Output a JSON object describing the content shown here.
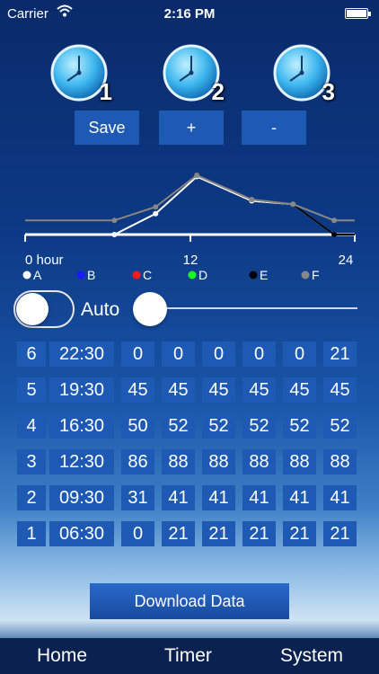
{
  "status": {
    "carrier": "Carrier",
    "time": "2:16 PM"
  },
  "clocks": [
    {
      "number": "1",
      "icon": "clock-icon"
    },
    {
      "number": "2",
      "icon": "clock-icon"
    },
    {
      "number": "3",
      "icon": "clock-icon"
    }
  ],
  "buttons": {
    "save": "Save",
    "plus": "+",
    "minus": "-"
  },
  "chart_data": {
    "type": "line",
    "x_ticks": [
      "0 hour",
      "12",
      "24"
    ],
    "xlim": [
      0,
      24
    ],
    "ylim": [
      0,
      100
    ],
    "legend": [
      {
        "name": "A",
        "color": "#ffffff"
      },
      {
        "name": "B",
        "color": "#1a1aff"
      },
      {
        "name": "C",
        "color": "#ff1a1a"
      },
      {
        "name": "D",
        "color": "#1aff1a"
      },
      {
        "name": "E",
        "color": "#000000"
      },
      {
        "name": "F",
        "color": "#888888"
      }
    ],
    "x": [
      6.5,
      9.5,
      12.5,
      16.5,
      19.5,
      22.5
    ],
    "series": [
      {
        "name": "A",
        "color": "#ffffff",
        "values": [
          0,
          31,
          86,
          50,
          45,
          0
        ]
      },
      {
        "name": "E",
        "color": "#000000",
        "values": [
          21,
          41,
          88,
          52,
          45,
          0
        ]
      },
      {
        "name": "F",
        "color": "#888888",
        "values": [
          21,
          41,
          88,
          52,
          45,
          21
        ]
      }
    ]
  },
  "controls": {
    "auto_label": "Auto",
    "auto_on": false,
    "slider_value": 0
  },
  "table": {
    "rows": [
      {
        "index": "6",
        "time": "22:30",
        "values": [
          "0",
          "0",
          "0",
          "0",
          "0",
          "21"
        ]
      },
      {
        "index": "5",
        "time": "19:30",
        "values": [
          "45",
          "45",
          "45",
          "45",
          "45",
          "45"
        ]
      },
      {
        "index": "4",
        "time": "16:30",
        "values": [
          "50",
          "52",
          "52",
          "52",
          "52",
          "52"
        ]
      },
      {
        "index": "3",
        "time": "12:30",
        "values": [
          "86",
          "88",
          "88",
          "88",
          "88",
          "88"
        ]
      },
      {
        "index": "2",
        "time": "09:30",
        "values": [
          "31",
          "41",
          "41",
          "41",
          "41",
          "41"
        ]
      },
      {
        "index": "1",
        "time": "06:30",
        "values": [
          "0",
          "21",
          "21",
          "21",
          "21",
          "21"
        ]
      }
    ]
  },
  "download_label": "Download Data",
  "tabs": [
    {
      "label": "Home"
    },
    {
      "label": "Timer"
    },
    {
      "label": "System"
    }
  ]
}
